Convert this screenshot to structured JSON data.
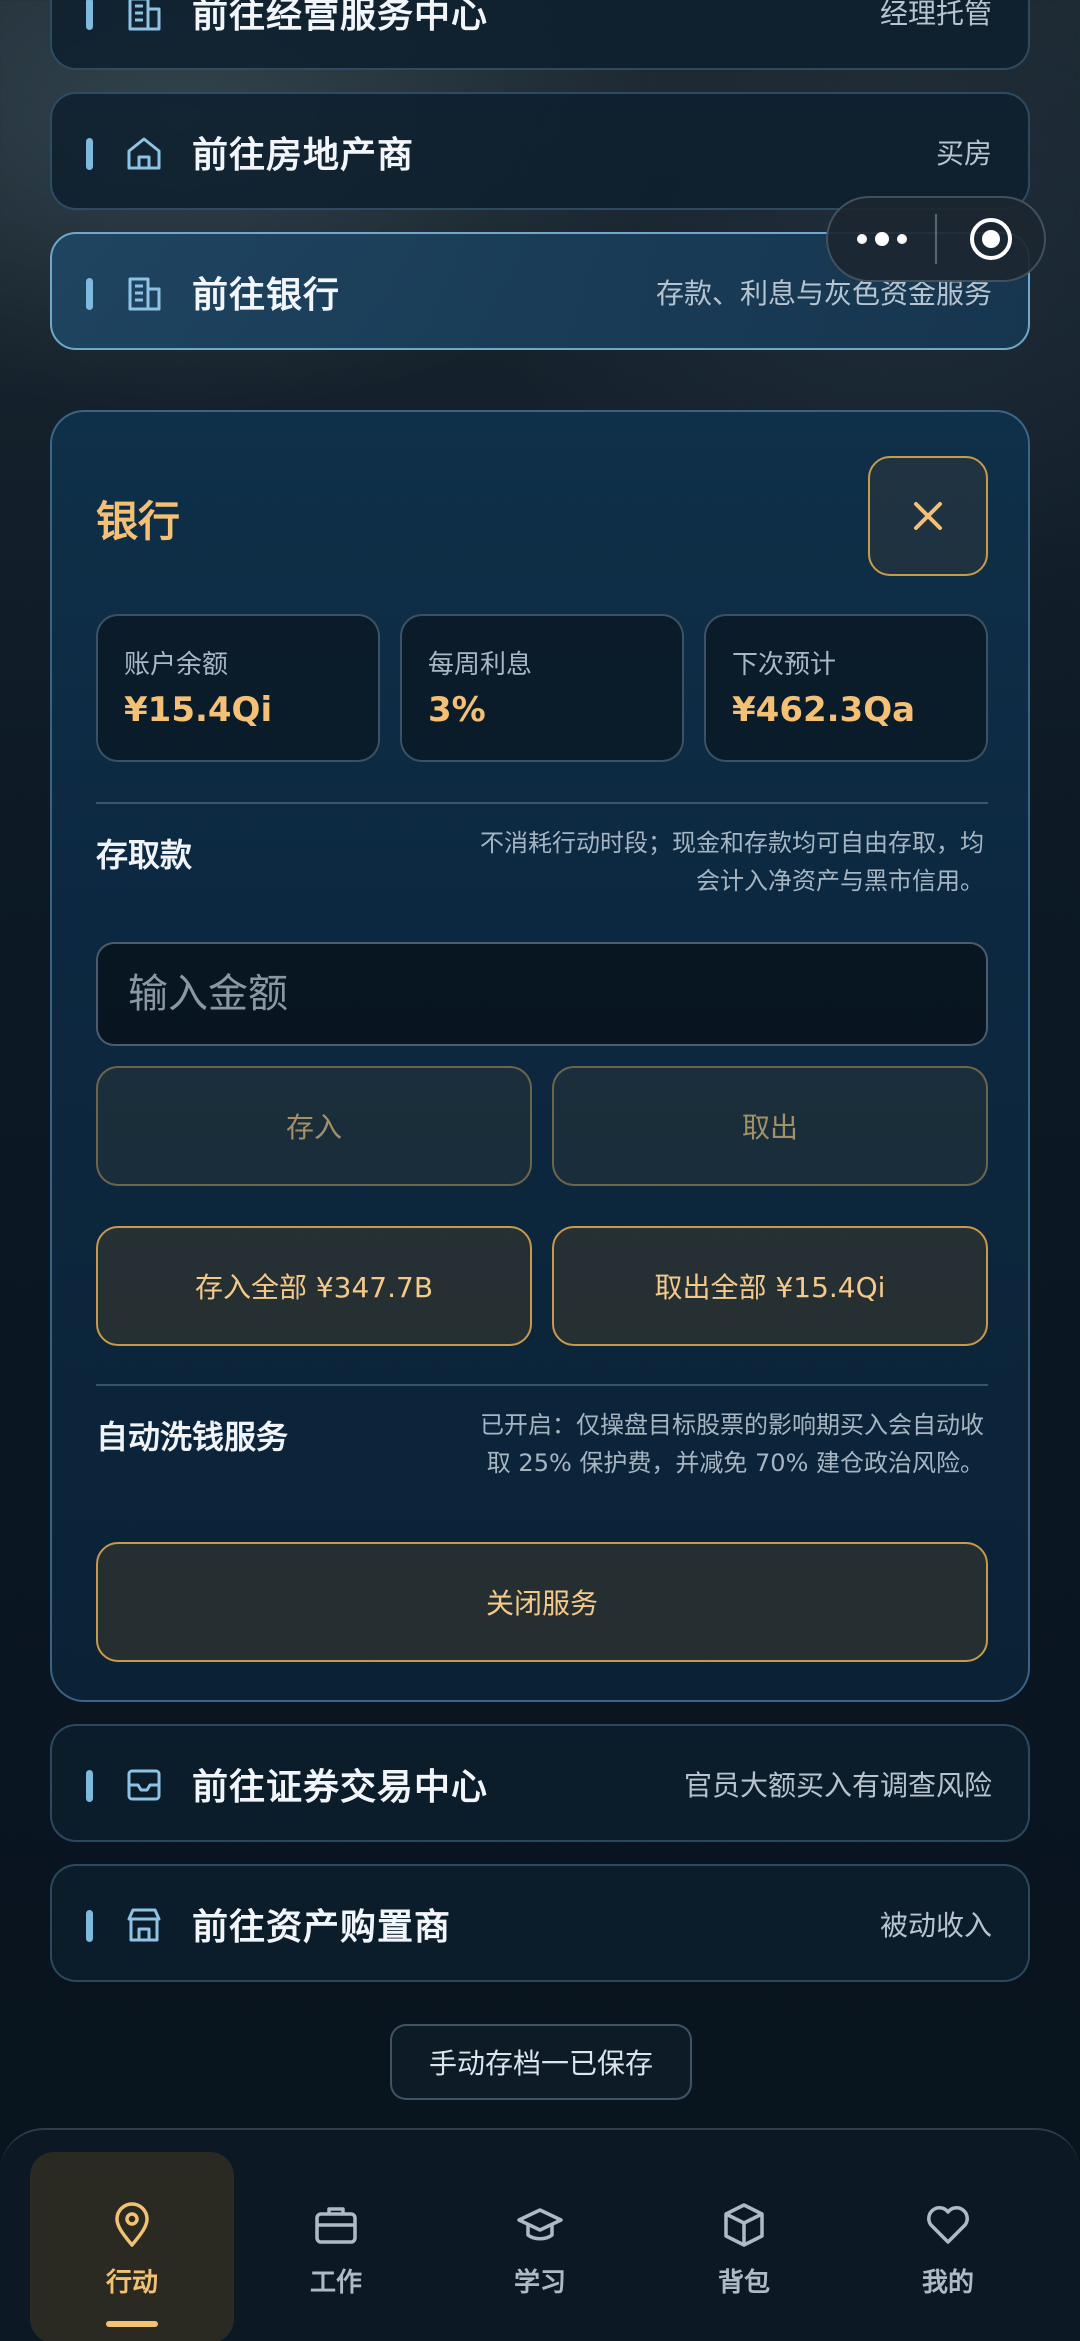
{
  "nav_items_top": [
    {
      "title": "前往经营服务中心",
      "note": "经理托管",
      "icon": "building-icon"
    },
    {
      "title": "前往房地产商",
      "note": "买房",
      "icon": "house-icon"
    },
    {
      "title": "前往银行",
      "note": "存款、利息与灰色资金服务",
      "icon": "bank-building-icon"
    }
  ],
  "bank": {
    "title": "银行",
    "stats": [
      {
        "label": "账户余额",
        "value": "¥15.4Qi"
      },
      {
        "label": "每周利息",
        "value": "3%"
      },
      {
        "label": "下次预计",
        "value": "¥462.3Qa"
      }
    ],
    "deposit_section": {
      "title": "存取款",
      "desc": "不消耗行动时段；现金和存款均可自由存取，均会计入净资产与黑市信用。",
      "input_placeholder": "输入金额",
      "deposit_label": "存入",
      "withdraw_label": "取出",
      "deposit_all_label": "存入全部 ¥347.7B",
      "withdraw_all_label": "取出全部 ¥15.4Qi"
    },
    "laundering_section": {
      "title": "自动洗钱服务",
      "desc": "已开启：仅操盘目标股票的影响期买入会自动收取 25% 保护费，并减免 70% 建仓政治风险。",
      "close_label": "关闭服务"
    }
  },
  "nav_items_bottom": [
    {
      "title": "前往证券交易中心",
      "note": "官员大额买入有调查风险",
      "icon": "mail-icon"
    },
    {
      "title": "前往资产购置商",
      "note": "被动收入",
      "icon": "store-icon"
    }
  ],
  "save_status": "手动存档一已保存",
  "tabs": [
    {
      "label": "行动",
      "icon": "location-pin-icon",
      "active": true
    },
    {
      "label": "工作",
      "icon": "briefcase-icon"
    },
    {
      "label": "学习",
      "icon": "graduation-cap-icon"
    },
    {
      "label": "背包",
      "icon": "package-icon"
    },
    {
      "label": "我的",
      "icon": "heart-icon"
    }
  ],
  "colors": {
    "accent_gold": "#f3c075",
    "accent_blue": "#7fb9de",
    "panel_bg": "#0c2840"
  }
}
